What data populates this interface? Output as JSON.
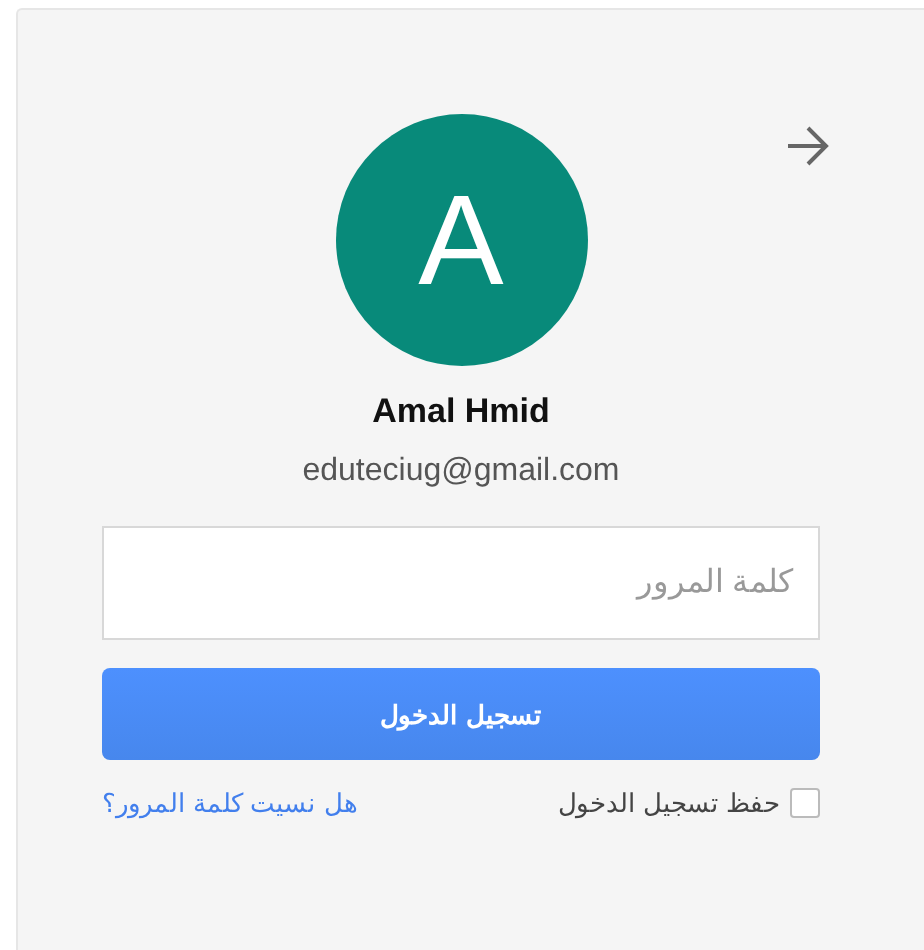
{
  "account": {
    "initial": "A",
    "name": "Amal Hmid",
    "email": "eduteciug@gmail.com"
  },
  "password": {
    "placeholder": "كلمة المرور"
  },
  "sign_in_button": "تسجيل الدخول",
  "remember": {
    "label": "حفظ تسجيل الدخول",
    "checked": false
  },
  "forgot_link": "هل نسيت كلمة المرور؟"
}
